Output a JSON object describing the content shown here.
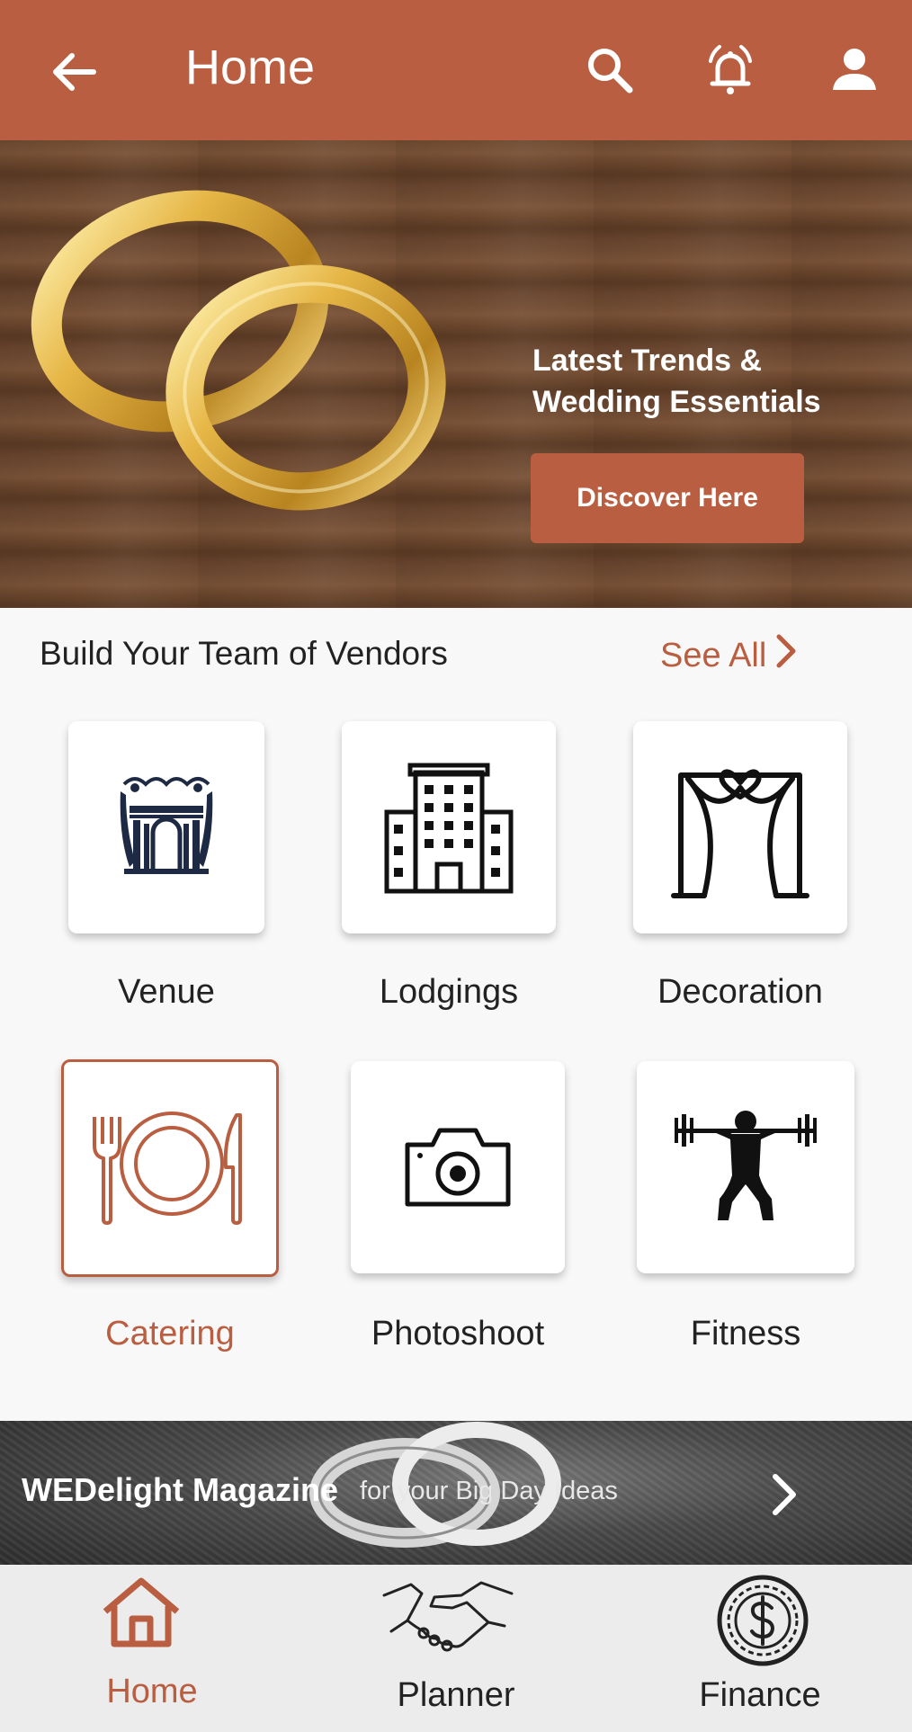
{
  "app_bar": {
    "title": "Home",
    "background": "#b95e40",
    "icons": [
      "back-arrow-icon",
      "search-icon",
      "alarm-bell-icon",
      "user-profile-icon"
    ]
  },
  "hero": {
    "headline": "Latest Trends & Wedding Essentials",
    "cta_label": "Discover Here",
    "image": "gold-wedding-rings-on-wood"
  },
  "vendors": {
    "section_title": "Build Your Team of Vendors",
    "see_all_label": "See All",
    "items": [
      {
        "label": "Venue",
        "icon": "venue-icon",
        "selected": false
      },
      {
        "label": "Lodgings",
        "icon": "hotel-building-icon",
        "selected": false
      },
      {
        "label": "Decoration",
        "icon": "heart-arch-icon",
        "selected": false
      },
      {
        "label": "Catering",
        "icon": "plate-fork-knife-icon",
        "selected": true
      },
      {
        "label": "Photoshoot",
        "icon": "camera-icon",
        "selected": false
      },
      {
        "label": "Fitness",
        "icon": "weightlifter-icon",
        "selected": false
      }
    ]
  },
  "magazine": {
    "title": "WEDelight Magazine",
    "subtitle": "for your Big Day Ideas"
  },
  "bottom_nav": {
    "items": [
      {
        "label": "Home",
        "icon": "home-icon",
        "active": true
      },
      {
        "label": "Planner",
        "icon": "handshake-icon",
        "active": false
      },
      {
        "label": "Finance",
        "icon": "dollar-coin-icon",
        "active": false
      }
    ]
  },
  "colors": {
    "accent": "#b95e40",
    "nav_background": "#ececec",
    "page_background": "#f8f8f8"
  }
}
